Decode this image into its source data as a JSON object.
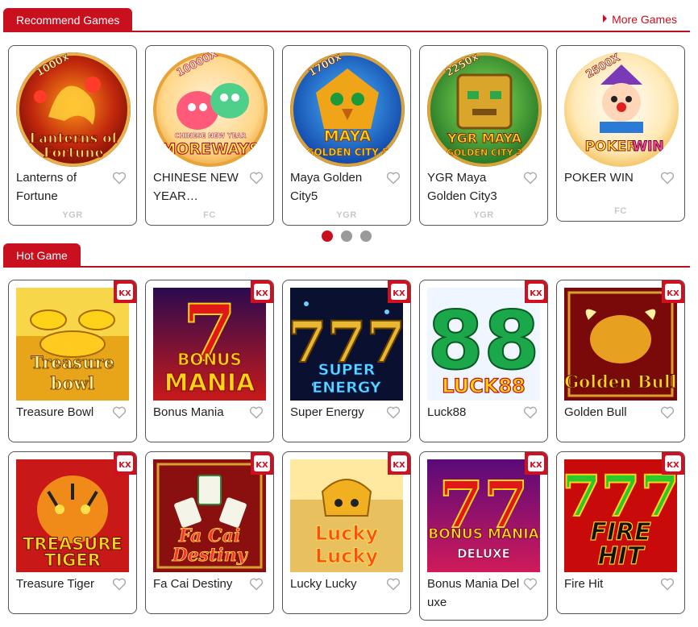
{
  "recommend": {
    "tab_label": "Recommend Games",
    "more_label": "More Games",
    "games": [
      {
        "title": "Lanterns of Fortune",
        "provider": "YGR",
        "multiplier": "1000x",
        "art_line1": "Lanterns of",
        "art_line2": "Fortune"
      },
      {
        "title": "CHINESE NEW YEAR MOREWAYS",
        "provider": "FC",
        "multiplier": "10000X",
        "art_line1": "CHINESE NEW YEAR",
        "art_line2": "MOREWAYS"
      },
      {
        "title": "Maya Golden City5",
        "provider": "YGR",
        "multiplier": "1700x",
        "art_line1": "MAYA",
        "art_line2": "GOLDEN CITY 5"
      },
      {
        "title": "YGR Maya Golden City3",
        "provider": "YGR",
        "multiplier": "2250x",
        "art_line1": "YGR MAYA",
        "art_line2": "GOLDEN CITY 3"
      },
      {
        "title": "POKER WIN",
        "provider": "FC",
        "multiplier": "2500X",
        "art_line1": "POKER",
        "art_line2": "WIN"
      }
    ],
    "pagination": {
      "pages": 3,
      "active": 1
    }
  },
  "hot": {
    "tab_label": "Hot Game",
    "badge_text": "KX",
    "games": [
      {
        "title": "Treasure Bowl",
        "art_line1": "Treasure",
        "art_line2": "bowl"
      },
      {
        "title": "Bonus Mania",
        "art_line1": "BONUS",
        "art_line2": "MANIA"
      },
      {
        "title": "Super Energy",
        "art_line1": "SUPER",
        "art_line2": "ENERGY"
      },
      {
        "title": "Luck88",
        "art_line1": "88",
        "art_line2": "LUCK88"
      },
      {
        "title": "Golden Bull",
        "art_line1": "",
        "art_line2": "Golden Bull"
      },
      {
        "title": "Treasure Tiger",
        "art_line1": "TREASURE",
        "art_line2": "TIGER"
      },
      {
        "title": "Fa Cai Destiny",
        "art_line1": "Fa Cai",
        "art_line2": "Destiny"
      },
      {
        "title": "Lucky Lucky",
        "art_line1": "Lucky",
        "art_line2": "Lucky"
      },
      {
        "title": "Bonus Mania Deluxe",
        "art_line1": "BONUS MANIA",
        "art_line2": "DELUXE"
      },
      {
        "title": "Fire Hit",
        "art_line1": "FIRE",
        "art_line2": "HIT"
      }
    ]
  },
  "colors": {
    "accent": "#c8101e",
    "dot_inactive": "#9a9a9a",
    "provider_text": "#c8c8c8"
  }
}
